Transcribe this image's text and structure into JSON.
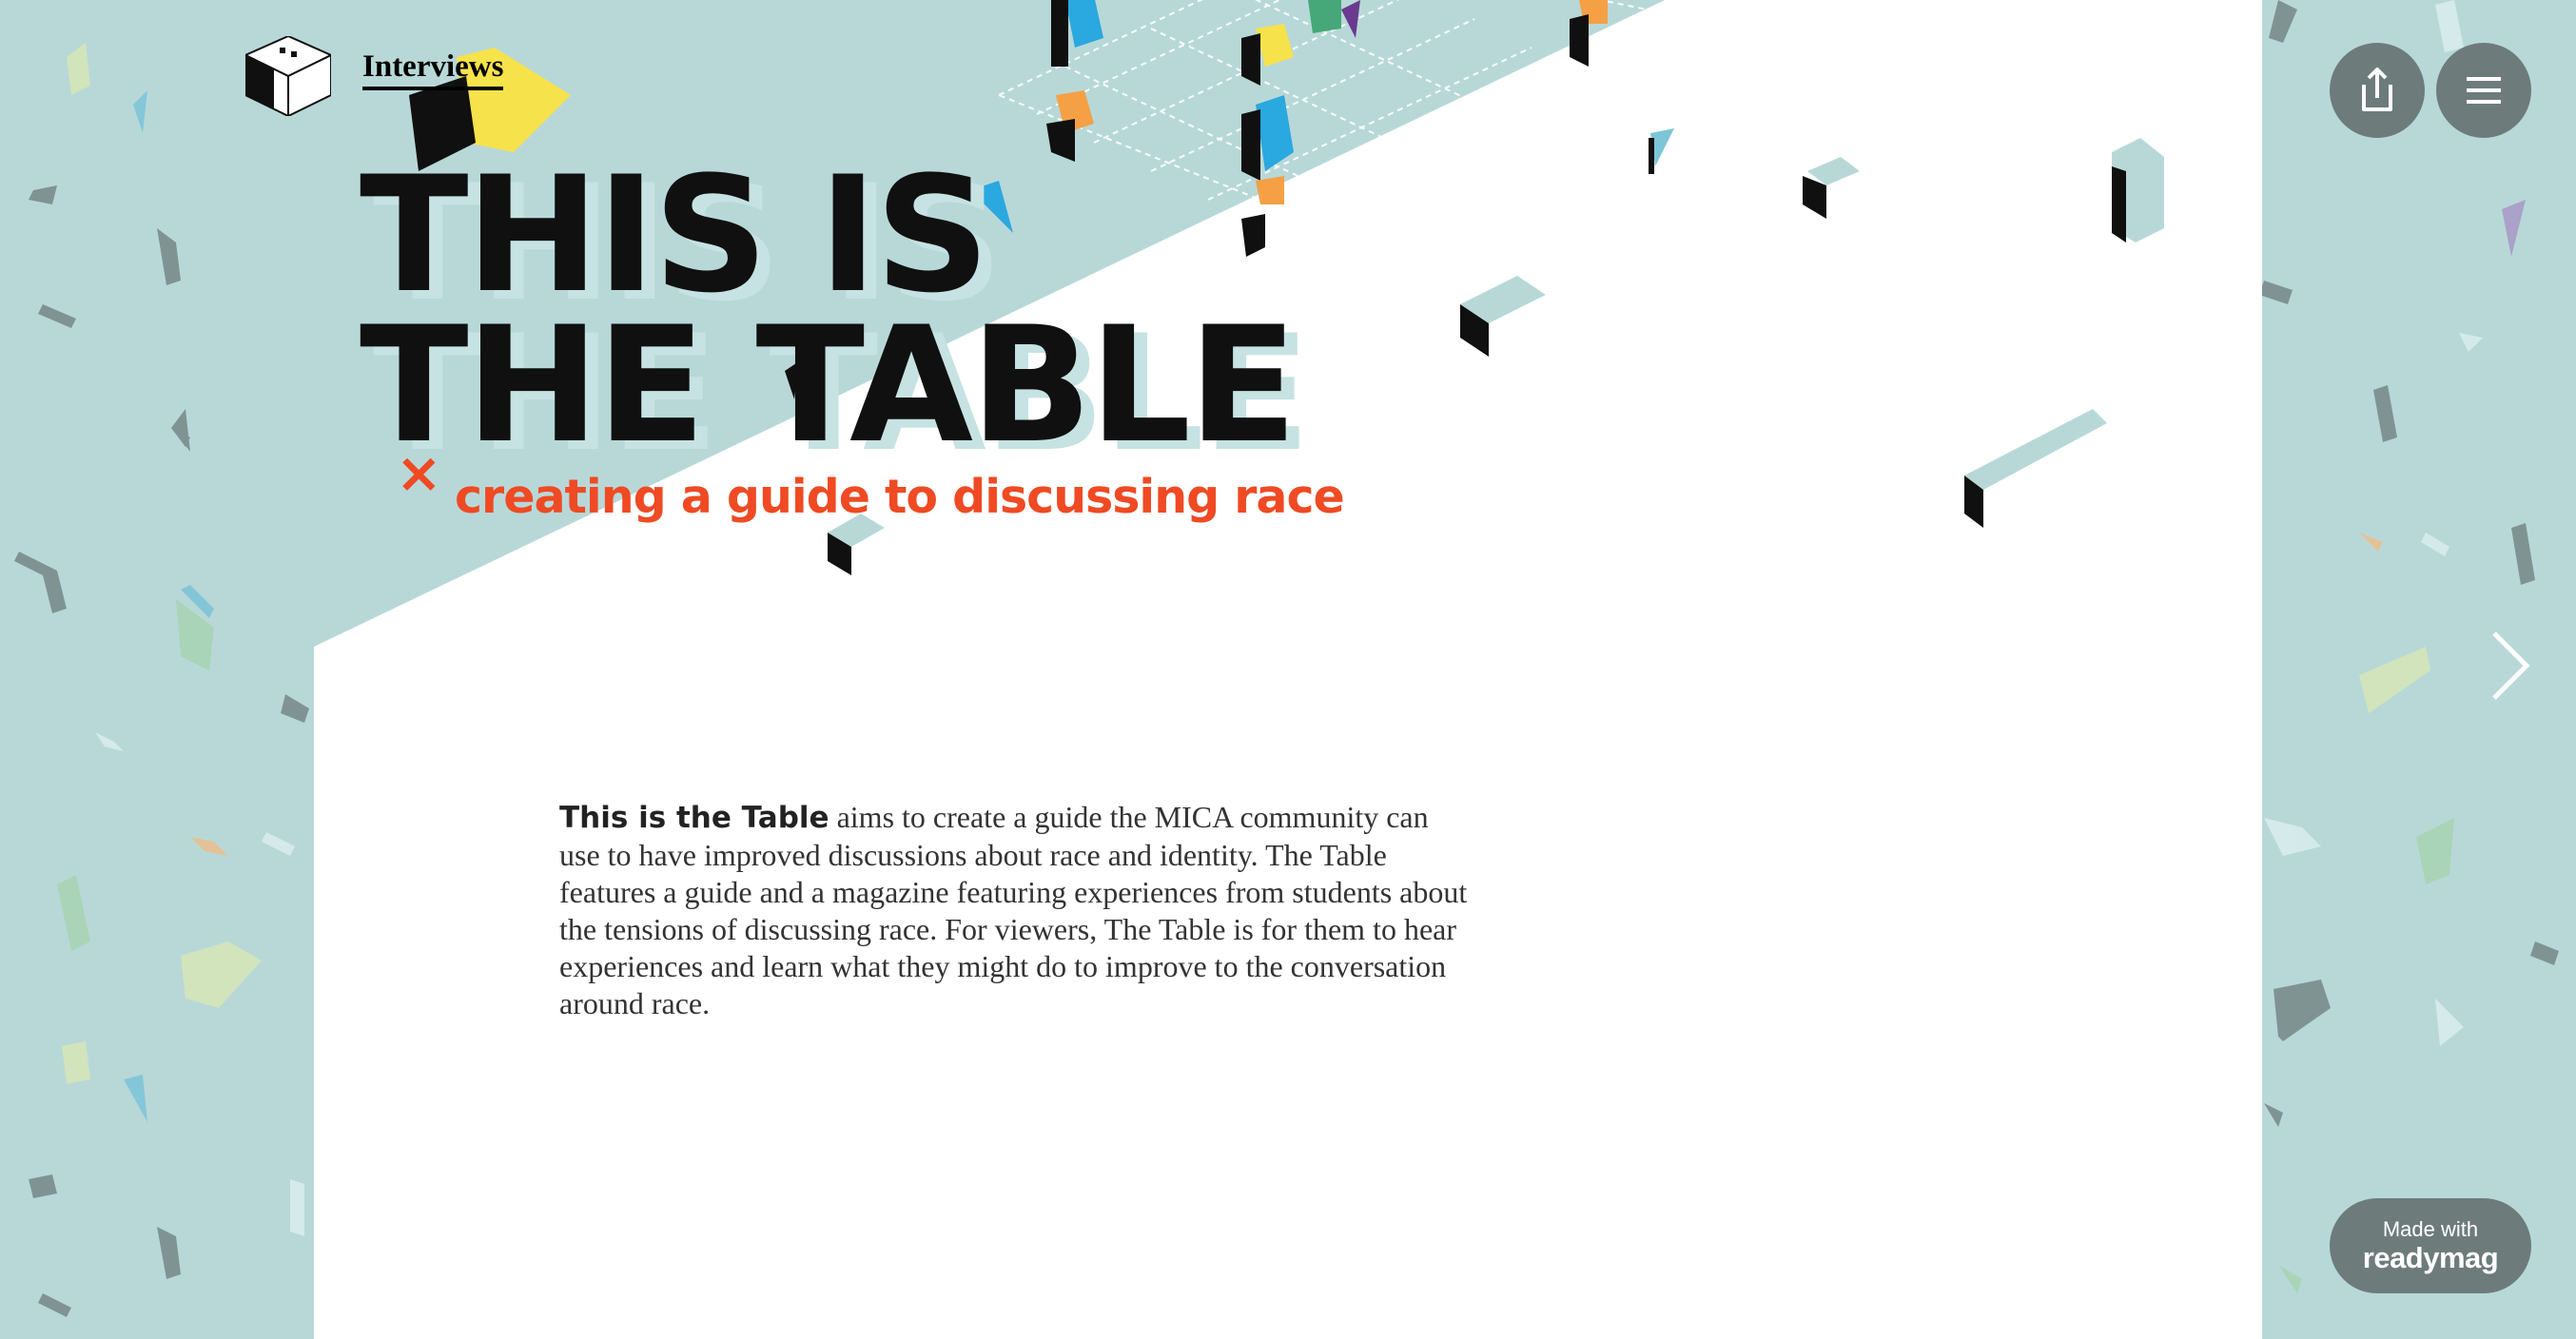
{
  "nav": {
    "link_label": "Interviews",
    "logo_icon": "box-cube-logo-icon"
  },
  "hero": {
    "title_line1": "THIS IS",
    "title_line2": "THE TABLE",
    "x_icon": "×",
    "subtitle": "creating a guide to discussing race"
  },
  "body": {
    "lead": "This is the Table",
    "text": " aims to create a guide the MICA community can use to have improved discussions about race and identity. The Table features a guide and a magazine featuring experiences from students about the tensions of discussing race. For viewers, The Table is for them to hear experiences and learn what they might do to improve to the conversation around race."
  },
  "controls": {
    "share_icon": "share-icon",
    "menu_icon": "hamburger-menu-icon",
    "next_icon": "chevron-right-icon"
  },
  "badge": {
    "line1": "Made with",
    "line2": "readymag"
  },
  "colors": {
    "background": "#b8d8d8",
    "page": "#ffffff",
    "accent": "#ef4a23",
    "button": "#6e7b7b",
    "title": "#101010"
  }
}
